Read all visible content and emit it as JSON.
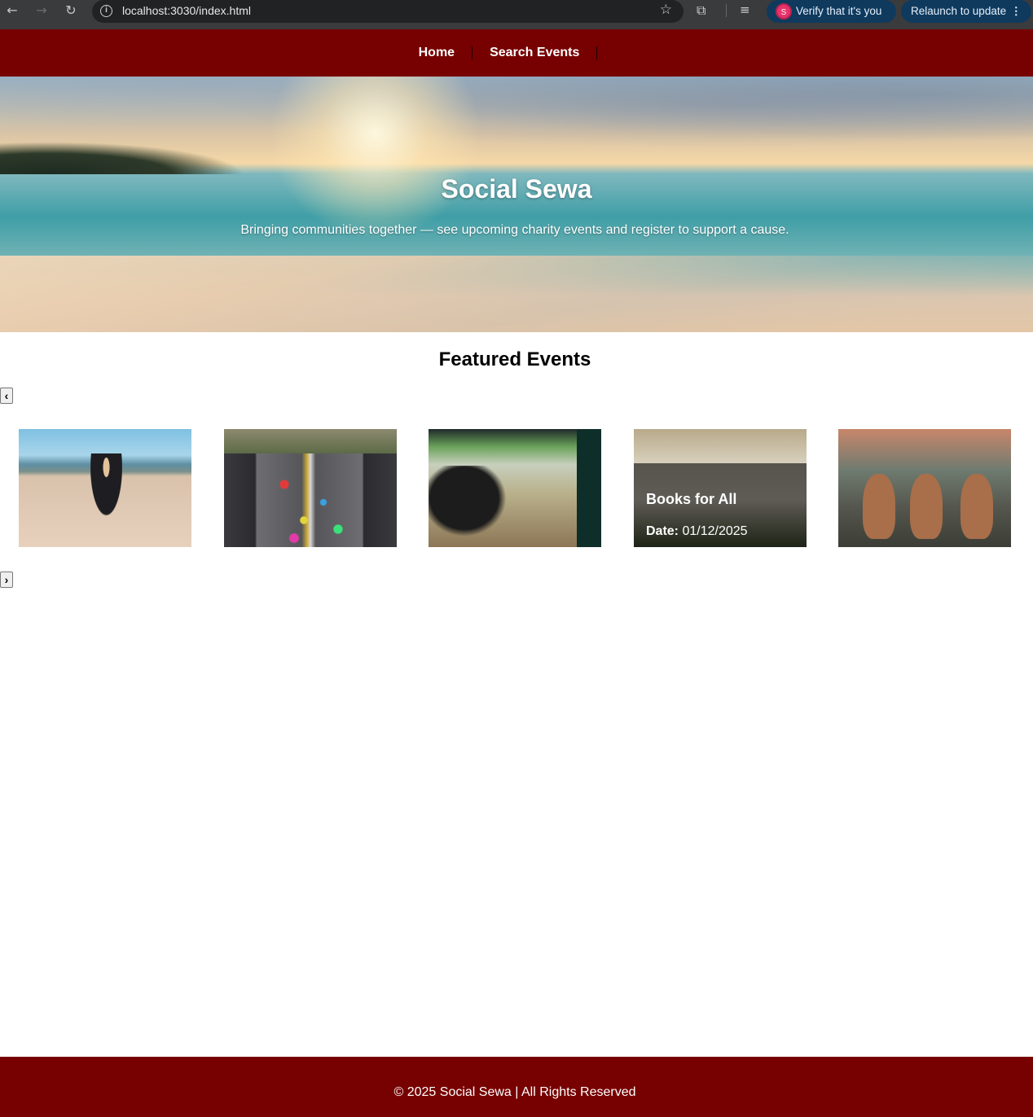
{
  "browser": {
    "url": "localhost:3030/index.html",
    "verify_label": "Verify that it's you",
    "verify_avatar": "S",
    "relaunch_label": "Relaunch to update"
  },
  "nav": {
    "items": [
      {
        "label": "Home"
      },
      {
        "label": "Search Events"
      }
    ]
  },
  "hero": {
    "title": "Social Sewa",
    "subtitle": "Bringing communities together — see upcoming charity events and register to support a cause."
  },
  "featured": {
    "title": "Featured Events",
    "prev_label": "‹",
    "next_label": "›",
    "cards": [
      {
        "image": "beach-cleanup-photo"
      },
      {
        "image": "marathon-photo"
      },
      {
        "image": "food-market-photo"
      },
      {
        "image": "book-exchange-photo",
        "title": "Books for All",
        "date_label": "Date:",
        "date": "01/12/2025"
      },
      {
        "image": "puppies-photo"
      }
    ]
  },
  "footer": {
    "text": "© 2025 Social Sewa | All Rights Reserved"
  },
  "colors": {
    "brand": "#770000",
    "chrome": "#3a3b3d"
  }
}
